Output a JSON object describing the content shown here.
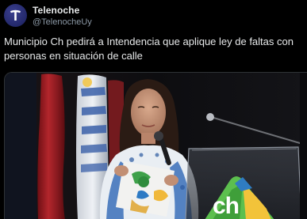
{
  "post": {
    "author": {
      "display_name": "Telenoche",
      "handle": "@TelenocheUy",
      "avatar_icon": "telenoche-t-logo-icon"
    },
    "text": "Municipio Ch pedirá a Intendencia que aplique ley de faltas con personas en situación de calle",
    "media": {
      "sign_text": "ch"
    }
  },
  "colors": {
    "background": "#000000",
    "primary_text": "#e7e9ea",
    "secondary_text": "#8b98a5",
    "avatar_bg": "#23286a"
  }
}
